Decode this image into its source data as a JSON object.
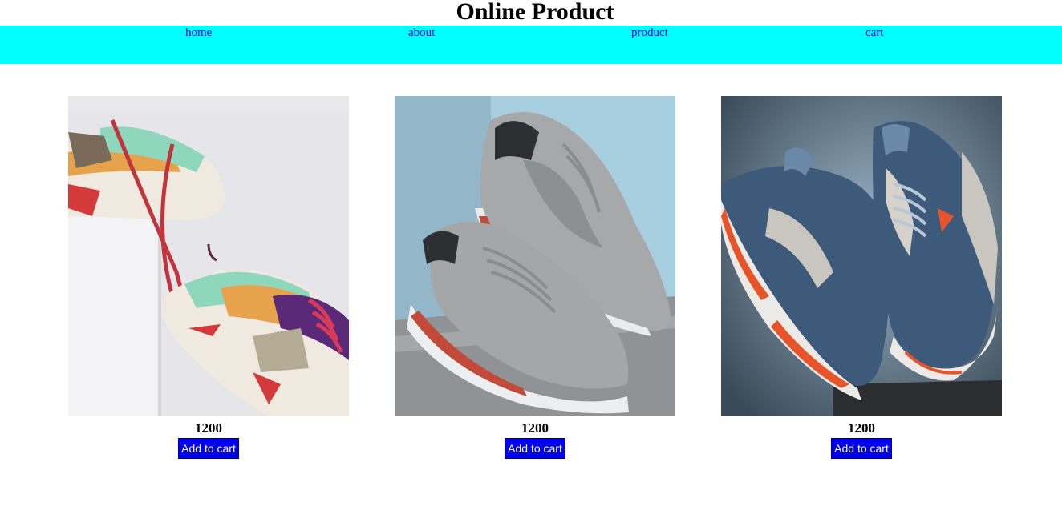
{
  "header": {
    "title": "Online Product"
  },
  "nav": {
    "items": [
      {
        "label": "home"
      },
      {
        "label": "about"
      },
      {
        "label": "product"
      },
      {
        "label": "cart"
      }
    ]
  },
  "products": [
    {
      "image": "sneaker-pastel-pair-photo",
      "price": "1200",
      "button_label": "Add to cart"
    },
    {
      "image": "sneaker-grey-pair-photo",
      "price": "1200",
      "button_label": "Add to cart"
    },
    {
      "image": "sneaker-blue-orange-pair-photo",
      "price": "1200",
      "button_label": "Add to cart"
    }
  ],
  "colors": {
    "nav_background": "#00ffff",
    "link": "#0000ee",
    "button_background": "#0000ee",
    "button_text": "#ffffff"
  }
}
